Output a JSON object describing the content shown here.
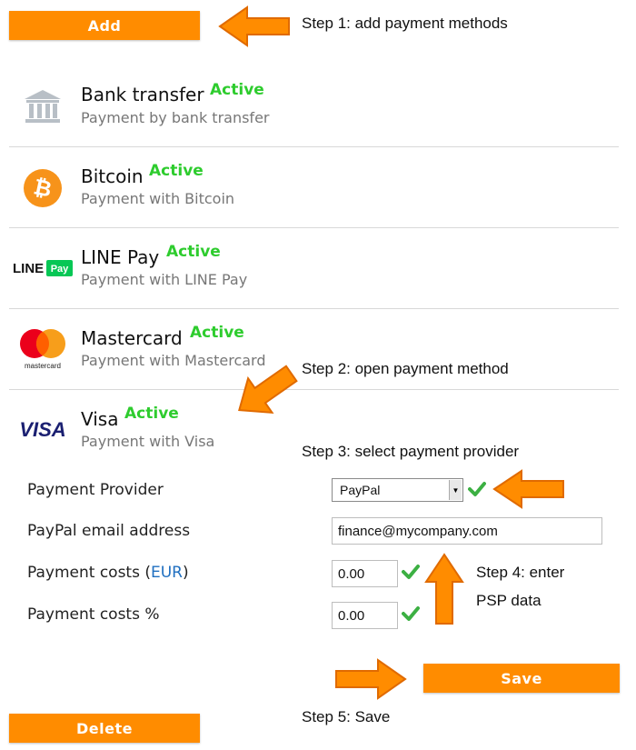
{
  "toolbar": {
    "add_label": "Add",
    "delete_label": "Delete",
    "save_label": "Save"
  },
  "steps": {
    "step1": "Step 1: add payment methods",
    "step2": "Step 2: open payment method",
    "step3": "Step 3: select payment provider",
    "step4_line1": "Step 4: enter",
    "step4_line2": "PSP data",
    "step5": "Step 5: Save"
  },
  "payment_methods": [
    {
      "name": "Bank transfer",
      "status": "Active",
      "description": "Payment by bank transfer",
      "icon": "bank-icon"
    },
    {
      "name": "Bitcoin",
      "status": "Active",
      "description": "Payment with Bitcoin",
      "icon": "bitcoin-icon"
    },
    {
      "name": "LINE Pay",
      "status": "Active",
      "description": "Payment with LINE Pay",
      "icon": "line-pay-logo",
      "logo_text": [
        "LINE",
        "Pay"
      ]
    },
    {
      "name": "Mastercard",
      "status": "Active",
      "description": "Payment with Mastercard",
      "icon": "mastercard-logo",
      "logo_text": "mastercard"
    },
    {
      "name": "Visa",
      "status": "Active",
      "description": "Payment with Visa",
      "icon": "visa-logo",
      "logo_text": "VISA"
    }
  ],
  "form": {
    "provider_label": "Payment Provider",
    "provider_value": "PayPal",
    "email_label": "PayPal email address",
    "email_value": "finance@mycompany.com",
    "costs_label_prefix": "Payment costs (",
    "costs_currency": "EUR",
    "costs_label_suffix": ")",
    "costs_value": "0.00",
    "costs_pct_label": "Payment costs %",
    "costs_pct_value": "0.00"
  },
  "colors": {
    "accent": "#ff8c00",
    "active": "#2ecc2e",
    "check": "#3cb043",
    "link": "#1f6fc0"
  }
}
